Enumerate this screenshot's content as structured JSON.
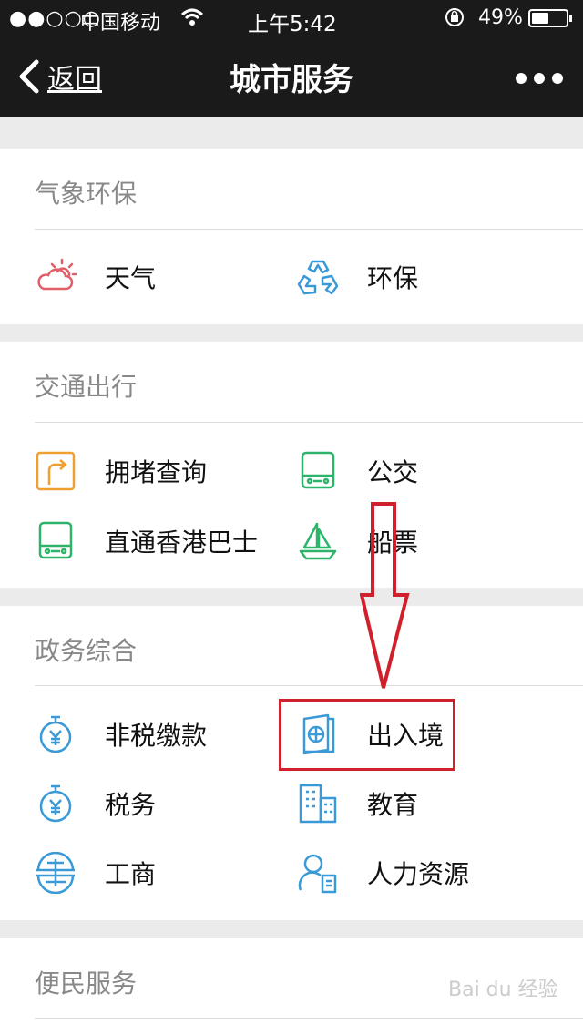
{
  "status_bar": {
    "signal": "●●○○○",
    "carrier": "中国移动",
    "time": "上午5:42",
    "battery": "49%"
  },
  "nav": {
    "back_label": "返回",
    "title": "城市服务"
  },
  "sections": [
    {
      "title": "气象环保",
      "items": [
        {
          "label": "天气",
          "icon": "cloud-sun-icon"
        },
        {
          "label": "环保",
          "icon": "recycle-icon"
        }
      ]
    },
    {
      "title": "交通出行",
      "items": [
        {
          "label": "拥堵查询",
          "icon": "traffic-sign-icon"
        },
        {
          "label": "公交",
          "icon": "bus-icon"
        },
        {
          "label": "直通香港巴士",
          "icon": "bus-icon"
        },
        {
          "label": "船票",
          "icon": "sailboat-icon"
        }
      ]
    },
    {
      "title": "政务综合",
      "items": [
        {
          "label": "非税缴款",
          "icon": "yen-stopwatch-icon"
        },
        {
          "label": "出入境",
          "icon": "passport-icon"
        },
        {
          "label": "税务",
          "icon": "yen-stopwatch-icon"
        },
        {
          "label": "教育",
          "icon": "building-icon"
        },
        {
          "label": "工商",
          "icon": "seal-icon"
        },
        {
          "label": "人力资源",
          "icon": "person-card-icon"
        }
      ]
    },
    {
      "title": "便民服务",
      "items": []
    }
  ],
  "watermark": "Bai du 经验",
  "colors": {
    "weather": "#e0606a",
    "green": "#2fb36b",
    "orange": "#f0a030",
    "blue": "#3a9ad8"
  }
}
